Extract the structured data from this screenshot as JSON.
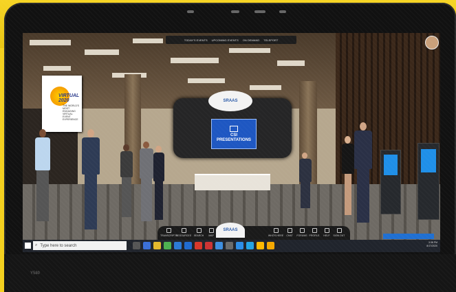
{
  "top_nav": {
    "items": [
      "TODAY'S EVENTS",
      "UPCOMING EVENTS",
      "ON DEMAND",
      "TELEPORT"
    ]
  },
  "hub": {
    "logo_text": "SRAAS",
    "csi_line1": "CSI",
    "csi_line2": "PRESENTATIONS"
  },
  "banner": {
    "title": "VIRTUAL 2020",
    "subtitle": "THE WORLD'S MOST ENGAGING VIRTUAL EVENT EXPERIENCE"
  },
  "bottom_bar": {
    "left_items": [
      "TRANSCRIPTS",
      "RESOURCES",
      "SEARCH",
      "MAP",
      "AGENDA"
    ],
    "right_items": [
      "WHO'S HERE",
      "CHAT",
      "FORUMS",
      "PROFILE",
      "HELP",
      "SIGN OUT"
    ],
    "logo_text": "SRAAS"
  },
  "taskbar": {
    "search_placeholder": "Type here to search",
    "time": "3:38 PM",
    "date": "8/17/2020"
  },
  "notification": {
    "label": "Events"
  },
  "laptop": {
    "brand": "Y580"
  },
  "colors": {
    "background_yellow": "#f4d01e",
    "csi_blue": "#1e57c2",
    "taskbar": "#20242c"
  }
}
